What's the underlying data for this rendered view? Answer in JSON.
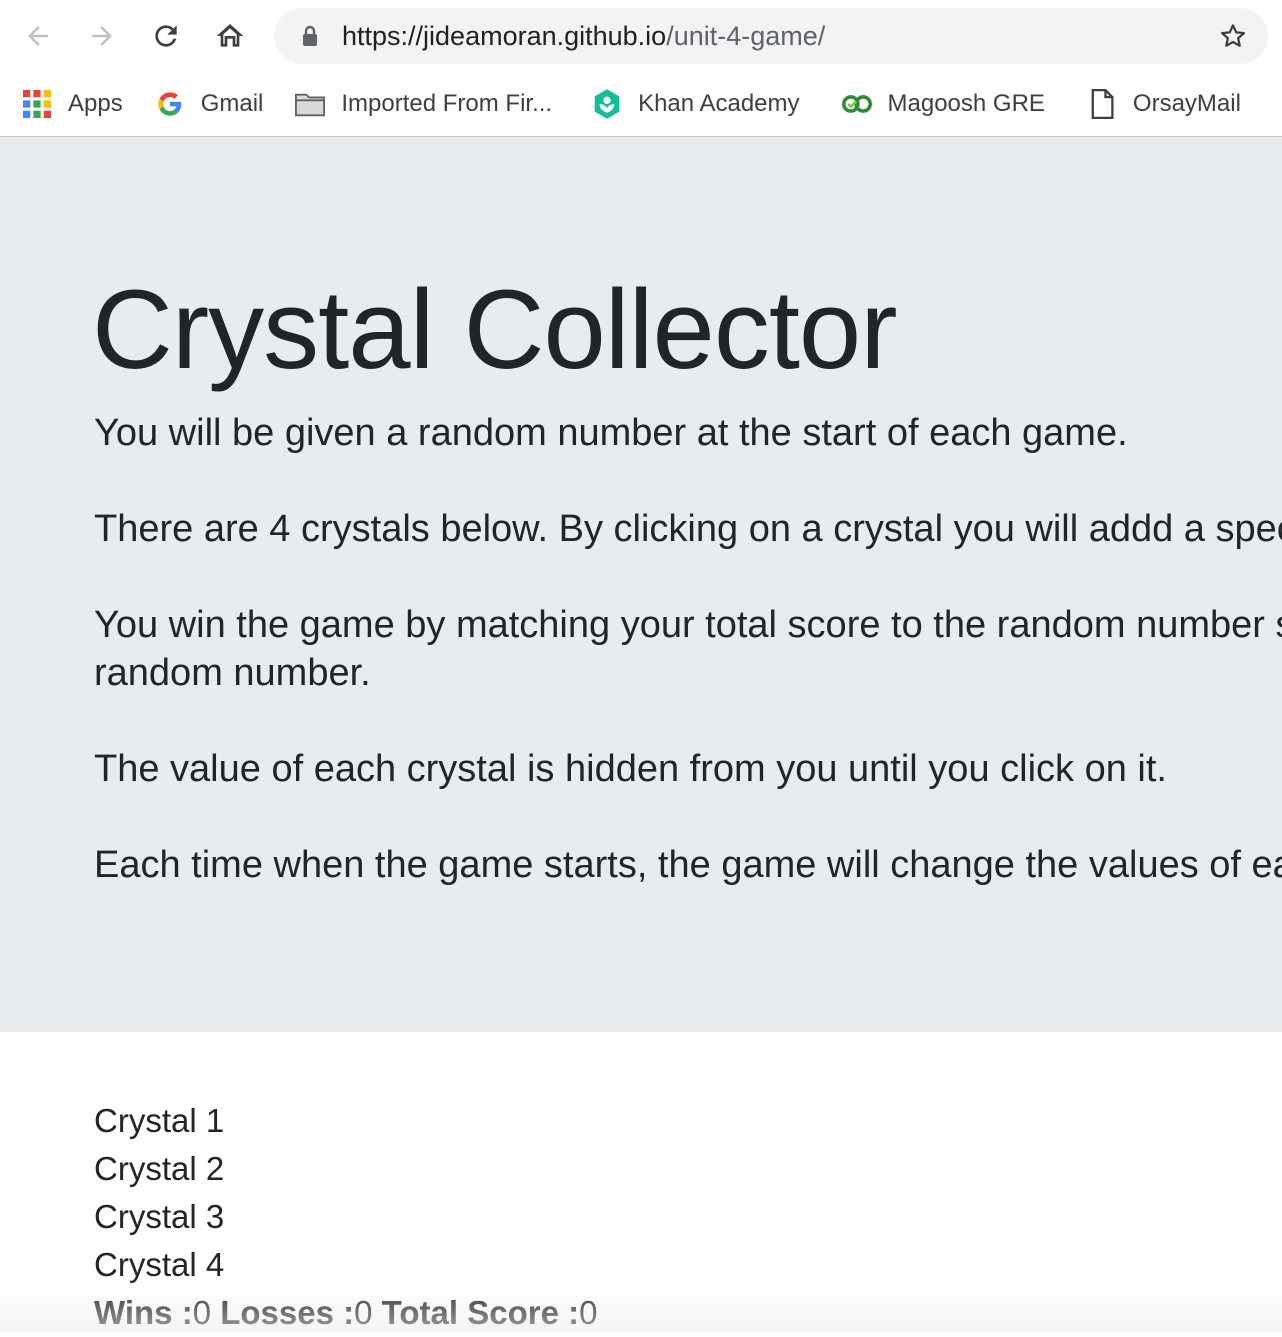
{
  "browser": {
    "url_host": "https://jideamoran.github.io",
    "url_path": "/unit-4-game/",
    "bookmarks": [
      {
        "label": "Apps",
        "icon": "apps-grid-icon"
      },
      {
        "label": "Gmail",
        "icon": "google-g-icon"
      },
      {
        "label": "Imported From Fir...",
        "icon": "folder-icon"
      },
      {
        "label": "Khan Academy",
        "icon": "khan-academy-icon"
      },
      {
        "label": "Magoosh GRE",
        "icon": "magoosh-icon"
      },
      {
        "label": "OrsayMail",
        "icon": "page-icon"
      }
    ]
  },
  "page": {
    "title": "Crystal Collector",
    "paragraphs": [
      "You will be given a random number at the start of each game.",
      "There are 4 crystals below. By clicking on a crystal you will addd a spec",
      "You win the game by matching your total score to the random number s",
      "random number.",
      "The value of each crystal is hidden from you until you click on it.",
      "Each time when the game starts, the game will change the values of ea"
    ],
    "crystals": [
      "Crystal 1",
      "Crystal 2",
      "Crystal 3",
      "Crystal 4"
    ],
    "score": {
      "wins_label": "Wins :",
      "wins": "0",
      "losses_label": "Losses :",
      "losses": "0",
      "total_label": "Total Score :",
      "total": "0"
    }
  }
}
